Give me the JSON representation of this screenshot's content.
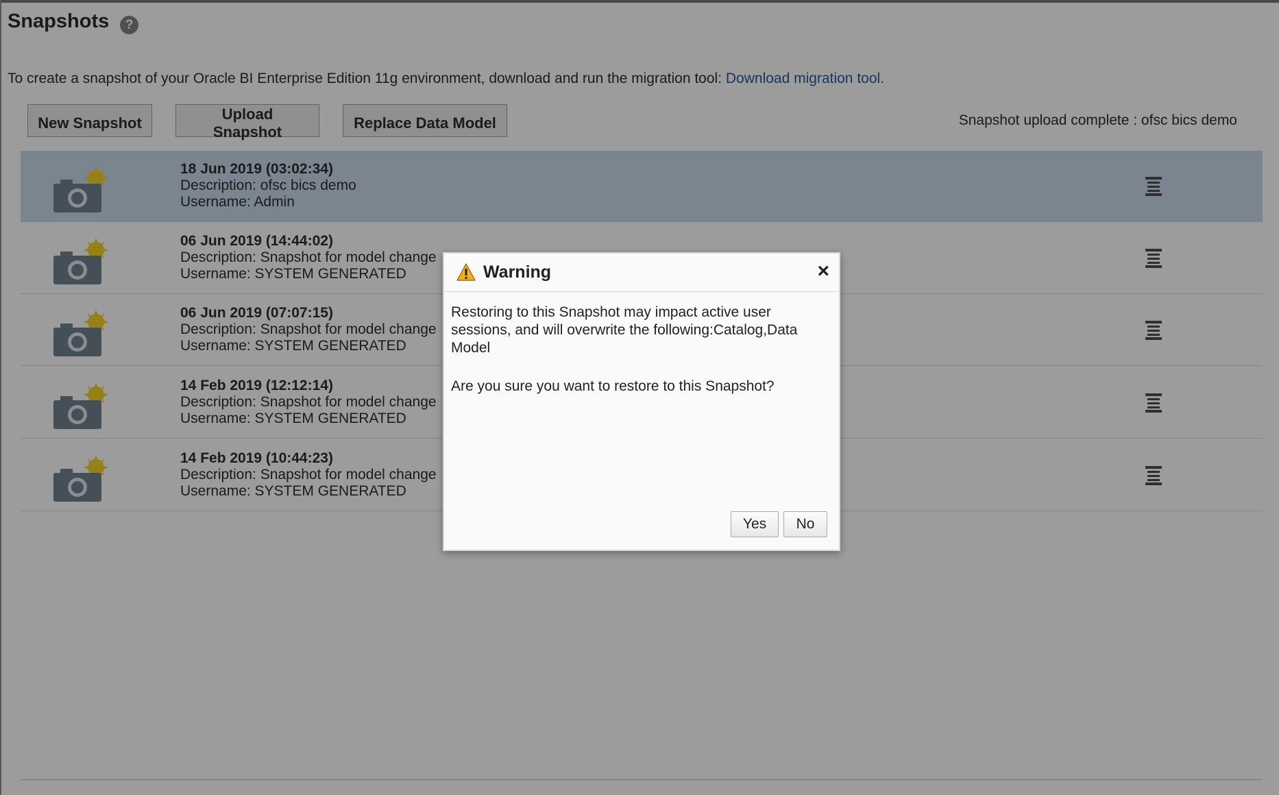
{
  "page": {
    "title": "Snapshots",
    "help_icon": "?",
    "intro_text": "To create a snapshot of your Oracle BI Enterprise Edition 11g environment, download and run the migration tool: ",
    "intro_link": "Download migration tool.",
    "upload_status": "Snapshot upload complete : ofsc bics demo"
  },
  "toolbar": {
    "new_snapshot": "New Snapshot",
    "upload_snapshot": "Upload Snapshot",
    "replace_data_model": "Replace Data Model"
  },
  "snapshots": [
    {
      "date": "18 Jun 2019 (03:02:34)",
      "description": "Description: ofsc bics demo",
      "username": "Username: Admin",
      "selected": true
    },
    {
      "date": "06 Jun 2019 (14:44:02)",
      "description": "Description: Snapshot for model change",
      "username": "Username: SYSTEM GENERATED",
      "selected": false
    },
    {
      "date": "06 Jun 2019 (07:07:15)",
      "description": "Description: Snapshot for model change",
      "username": "Username: SYSTEM GENERATED",
      "selected": false
    },
    {
      "date": "14 Feb 2019 (12:12:14)",
      "description": "Description: Snapshot for model change",
      "username": "Username: SYSTEM GENERATED",
      "selected": false
    },
    {
      "date": "14 Feb 2019 (10:44:23)",
      "description": "Description: Snapshot for model change",
      "username": "Username: SYSTEM GENERATED",
      "selected": false
    }
  ],
  "dialog": {
    "title": "Warning",
    "close": "×",
    "message": "Restoring to this Snapshot may impact active user sessions, and will overwrite the following:Catalog,Data Model",
    "question": "Are you sure you want to restore to this Snapshot?",
    "yes": "Yes",
    "no": "No",
    "icon": "warning-triangle-icon"
  },
  "colors": {
    "link": "#1f4f8f",
    "selected_row": "#c4d8ea",
    "warning": "#f2b21b",
    "camera": "#6a7b8b",
    "flash": "#f5d11c"
  }
}
